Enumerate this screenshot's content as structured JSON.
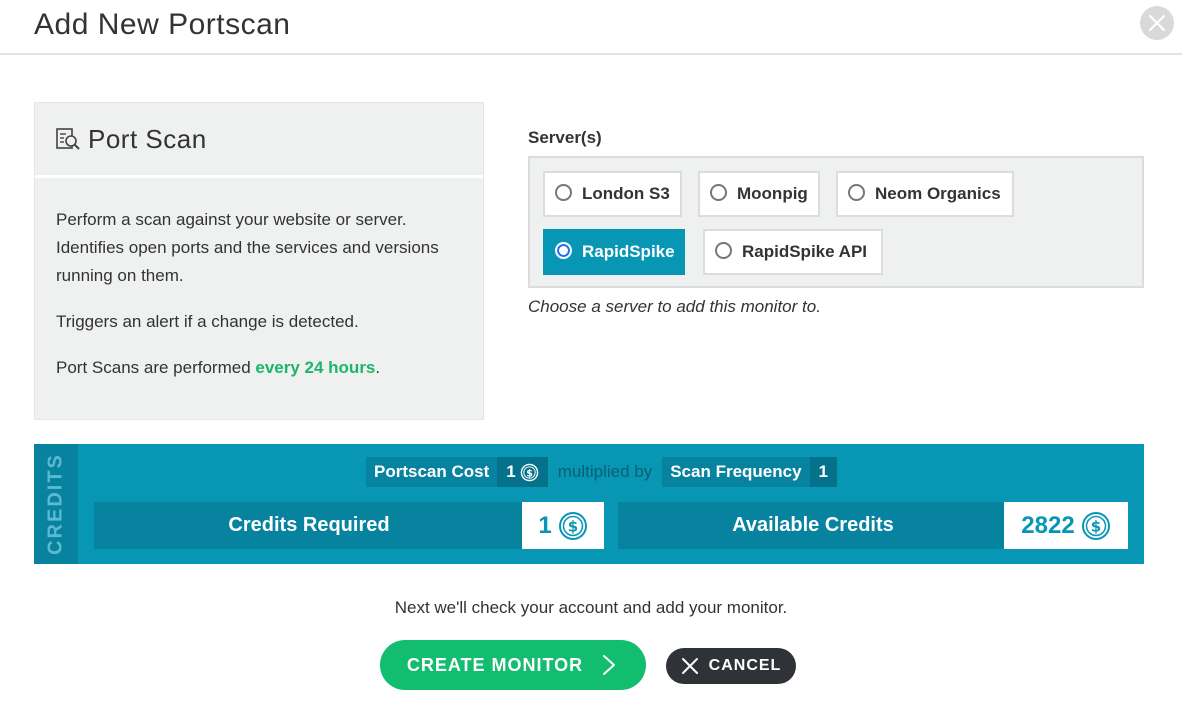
{
  "dialog": {
    "title": "Add New Portscan",
    "close_icon": "close-icon"
  },
  "info": {
    "heading": "Port Scan",
    "heading_icon": "scan-search-icon",
    "para1": "Perform a scan against your website or server. Identifies open ports and the services and versions running on them.",
    "para2": "Triggers an alert if a change is detected.",
    "para3_prefix": "Port Scans are performed ",
    "para3_highlight": "every 24 hours",
    "para3_suffix": ".",
    "highlight_color": "#1db56b"
  },
  "servers": {
    "label": "Server(s)",
    "options": [
      {
        "label": "London S3",
        "selected": false
      },
      {
        "label": "Moonpig",
        "selected": false
      },
      {
        "label": "Neom Organics",
        "selected": false
      },
      {
        "label": "RapidSpike",
        "selected": true
      },
      {
        "label": "RapidSpike API",
        "selected": false
      }
    ],
    "hint": "Choose a server to add this monitor to."
  },
  "credits": {
    "side_label": "CREDITS",
    "cost_label": "Portscan Cost",
    "cost_value": "1",
    "multiplied_by": "multiplied by",
    "freq_label": "Scan Frequency",
    "freq_value": "1",
    "required_label": "Credits Required",
    "required_value": "1",
    "available_label": "Available Credits",
    "available_value": "2822",
    "coin_icon": "coin-dollar-icon",
    "accent_color": "#0896b5"
  },
  "footer": {
    "next_text": "Next we'll check your account and add your monitor.",
    "create_label": "CREATE MONITOR",
    "create_color": "#13bd6f",
    "cancel_label": "CANCEL",
    "cancel_color": "#2f3337"
  }
}
